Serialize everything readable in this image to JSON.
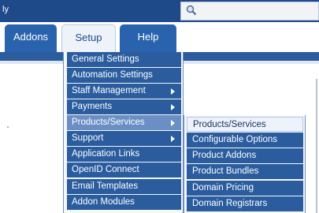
{
  "topbar": {
    "title_fragment": "ly"
  },
  "search": {
    "icon": "magnifier-icon"
  },
  "nav": {
    "tabs": [
      {
        "label": "Addons",
        "active": false
      },
      {
        "label": "Setup",
        "active": true
      },
      {
        "label": "Help",
        "active": false
      }
    ]
  },
  "setup_menu": {
    "items": [
      {
        "label": "General Settings",
        "has_submenu": false
      },
      {
        "label": "Automation Settings",
        "has_submenu": false
      },
      {
        "label": "Staff Management",
        "has_submenu": true
      },
      {
        "label": "Payments",
        "has_submenu": true
      },
      {
        "label": "Products/Services",
        "has_submenu": true,
        "highlighted": true
      },
      {
        "label": "Support",
        "has_submenu": true
      },
      {
        "label": "Application Links",
        "has_submenu": false
      },
      {
        "label": "OpenID Connect",
        "has_submenu": false
      },
      {
        "label": "Email Templates",
        "has_submenu": false
      },
      {
        "label": "Addon Modules",
        "has_submenu": false
      }
    ]
  },
  "products_submenu": {
    "items": [
      {
        "label": "Products/Services",
        "active": true
      },
      {
        "label": "Configurable Options",
        "active": false
      },
      {
        "label": "Product Addons",
        "active": false
      },
      {
        "label": "Product Bundles",
        "active": false
      },
      {
        "label": "Domain Pricing",
        "active": false
      },
      {
        "label": "Domain Registrars",
        "active": false
      }
    ]
  },
  "colors": {
    "nav_blue": "#2a5c9e",
    "header_blue": "#1f4a8a",
    "hover_blue": "#6b8fc4",
    "active_bg": "#eef3fb"
  }
}
